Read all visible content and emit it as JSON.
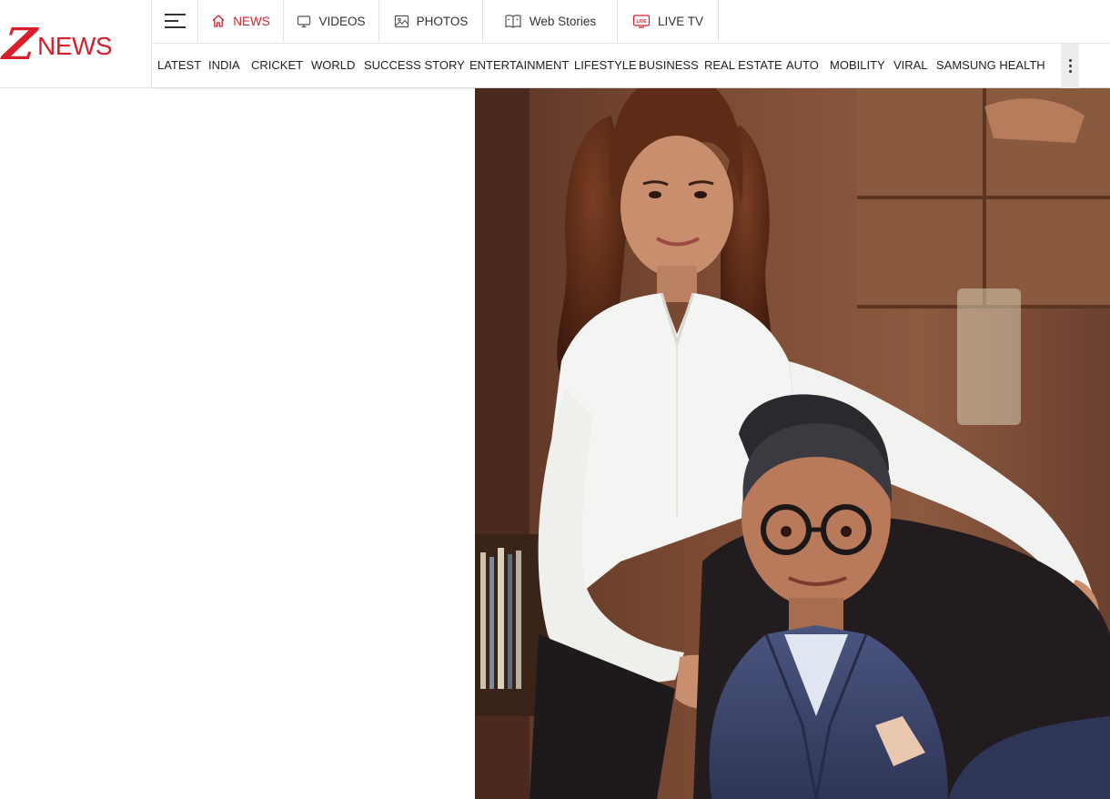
{
  "brand": {
    "logo_letter": "Z",
    "logo_word": "NEWS",
    "accent_color": "#d81e2a"
  },
  "topnav": {
    "menu_icon": "hamburger-menu-icon",
    "tabs": [
      {
        "label": "NEWS",
        "icon": "home-icon",
        "active": true
      },
      {
        "label": "VIDEOS",
        "icon": "monitor-icon",
        "active": false
      },
      {
        "label": "PHOTOS",
        "icon": "image-icon",
        "active": false
      },
      {
        "label": "Web Stories",
        "icon": "web-stories-icon",
        "active": false
      },
      {
        "label": "LIVE TV",
        "icon": "live-tv-icon",
        "active": false
      }
    ]
  },
  "secnav": {
    "items": [
      {
        "label": "LATEST"
      },
      {
        "label": "INDIA"
      },
      {
        "label": "CRICKET"
      },
      {
        "label": "WORLD"
      },
      {
        "label": "SUCCESS STORY"
      },
      {
        "label": "ENTERTAINMENT"
      },
      {
        "label": "LIFESTYLE"
      },
      {
        "label": "BUSINESS"
      },
      {
        "label": "REAL ESTATE"
      },
      {
        "label": "AUTO"
      },
      {
        "label": "MOBILITY"
      },
      {
        "label": "VIRAL"
      },
      {
        "label": "SAMSUNG HEALTH"
      }
    ],
    "more_icon": "more-vertical-icon"
  },
  "article": {
    "image_subject": "portrait-photo-woman-standing-man-seated"
  }
}
